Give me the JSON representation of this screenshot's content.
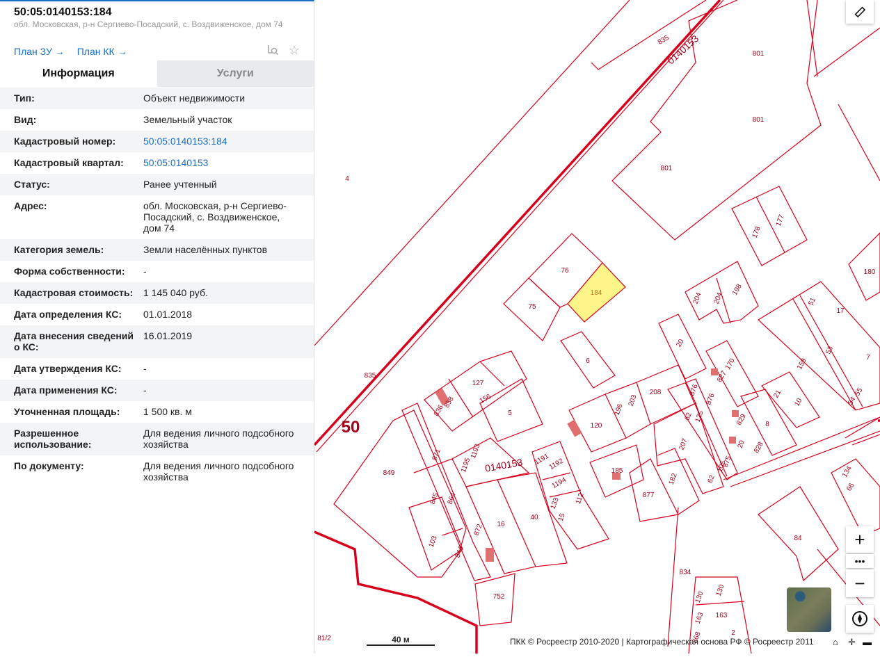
{
  "header": {
    "title": "50:05:0140153:184",
    "address": "обл. Московская, р-н Сергиево-Посадский, с. Воздвиженское, дом 74",
    "plan_zu": "План ЗУ →",
    "plan_kk": "План КК →"
  },
  "tabs": [
    {
      "label": "Информация"
    },
    {
      "label": "Услуги"
    }
  ],
  "rows": [
    {
      "k": "Тип:",
      "v": "Объект недвижимости"
    },
    {
      "k": "Вид:",
      "v": "Земельный участок"
    },
    {
      "k": "Кадастровый номер:",
      "v": "50:05:0140153:184"
    },
    {
      "k": "Кадастровый квартал:",
      "v": "50:05:0140153"
    },
    {
      "k": "Статус:",
      "v": "Ранее учтенный"
    },
    {
      "k": "Адрес:",
      "v": "обл. Московская, р-н Сергиево-Посадский, с. Воздвиженское, дом 74"
    },
    {
      "k": "Категория земель:",
      "v": "Земли населённых пунктов"
    },
    {
      "k": "Форма собственности:",
      "v": "-"
    },
    {
      "k": "Кадастровая стоимость:",
      "v": "1 145 040 руб."
    },
    {
      "k": "Дата определения КС:",
      "v": "01.01.2018"
    },
    {
      "k": "Дата внесения сведений о КС:",
      "v": "16.01.2019"
    },
    {
      "k": "Дата утверждения КС:",
      "v": "-"
    },
    {
      "k": "Дата применения КС:",
      "v": "-"
    },
    {
      "k": "Уточненная площадь:",
      "v": "1 500 кв. м"
    },
    {
      "k": "Разрешенное использование:",
      "v": "Для ведения личного подсобного хозяйства"
    },
    {
      "k": "По документу:",
      "v": "Для ведения личного подсобного хозяйства"
    }
  ],
  "map": {
    "labels": [
      "835",
      "0140153",
      "801",
      "801",
      "801",
      "4",
      "178",
      "177",
      "76",
      "184",
      "75",
      "204",
      "204",
      "198",
      "180",
      "51",
      "17",
      "53",
      "7",
      "20",
      "6",
      "170",
      "827",
      "159",
      "835",
      "127",
      "836",
      "858",
      "156",
      "5",
      "208",
      "203",
      "196",
      "120",
      "876",
      "125",
      "876",
      "62",
      "829",
      "21",
      "10",
      "8",
      "54",
      "55",
      "50",
      "849",
      "871",
      "1193",
      "1195",
      "0140153",
      "1191",
      "1192",
      "1194",
      "185",
      "207",
      "182",
      "875",
      "20",
      "828",
      "105",
      "62",
      "877",
      "845",
      "864",
      "133",
      "15",
      "112",
      "872",
      "16",
      "40",
      "103",
      "844",
      "752",
      "84",
      "834",
      "130",
      "130",
      "163",
      "163",
      "868",
      "2",
      "81/2",
      "134",
      "66"
    ],
    "scale": "40 м",
    "attribution": "ПКК © Росреестр 2010-2020 | Картографическая основа РФ © Росреестр 2011",
    "colors": {
      "parcel": "#d6001c",
      "selected": "#fff68a"
    }
  }
}
